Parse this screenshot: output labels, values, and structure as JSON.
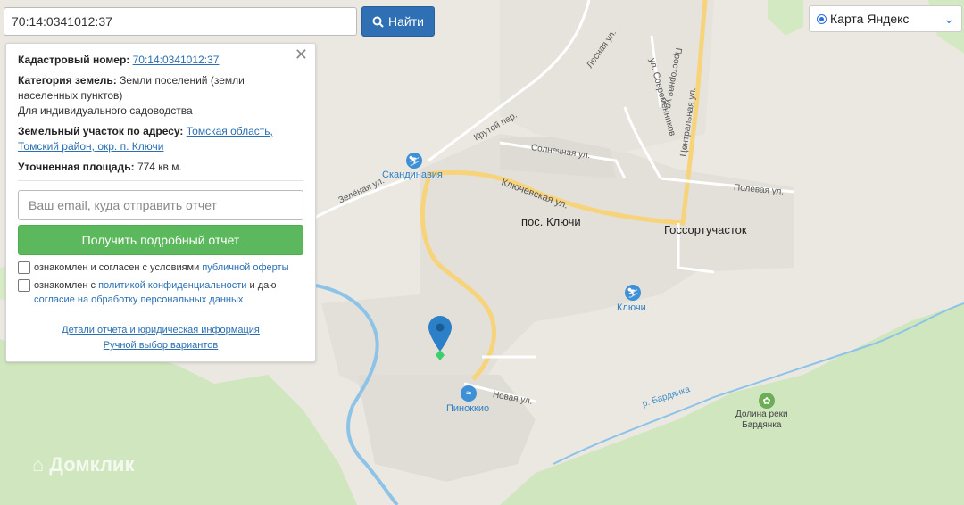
{
  "search": {
    "value": "70:14:0341012:37",
    "button_label": "Найти"
  },
  "map_type": {
    "selected": "Карта Яндекс"
  },
  "panel": {
    "cadastral_label": "Кадастровый номер:",
    "cadastral_value": "70:14:0341012:37",
    "category_label": "Категория земель:",
    "category_value": "Земли поселений (земли населенных пунктов)",
    "category_use": "Для индивидуального садоводства",
    "address_label": "Земельный участок по адресу:",
    "address_value": "Томская область, Томский район, окр. п. Ключи",
    "area_label": "Уточненная площадь:",
    "area_value": "774 кв.м.",
    "email_placeholder": "Ваш email, куда отправить отчет",
    "report_button": "Получить подробный отчет",
    "consent1_text": "ознакомлен и согласен с условиями ",
    "consent1_link": "публичной оферты",
    "consent2_text": "ознакомлен с ",
    "consent2_link": "политикой конфиденциальности",
    "consent2_mid": " и даю",
    "consent2_link2": "согласие на обработку персональных данных",
    "details_link": "Детали отчета и юридическая информация",
    "manual_link": "Ручной выбор вариантов"
  },
  "map_labels": {
    "lesnaya": "Лесная ул.",
    "krutoy": "Крутой пер.",
    "sovremennikov": "ул. Современников",
    "prostornaya": "Просторная ул.",
    "centralnaya": "Центральная ул.",
    "solnechnaya": "Солнечная ул.",
    "klyuchevskaya": "Ключевская ул.",
    "polevaya": "Полевая ул.",
    "zelenaya": "Зелёная ул.",
    "novaya": "Новая ул.",
    "bardyanka": "р. Бардянка",
    "pos_klyuchi": "пос. Ключи",
    "gossort": "Госсортучасток",
    "skandinavia": "Скандинавия",
    "klyuchi_poi": "Ключи",
    "pinokkio": "Пинок­кио",
    "dolina1": "Долина реки",
    "dolina2": "Бардянка"
  },
  "watermark": "Домклик",
  "colors": {
    "search_button": "#2f6fb3",
    "report_button": "#5cb85c",
    "link": "#2a6fb3",
    "marker": "#2b80c8",
    "forest": "#c9e3b8",
    "river": "#8ec3e8",
    "road_main": "#f7d37a"
  }
}
